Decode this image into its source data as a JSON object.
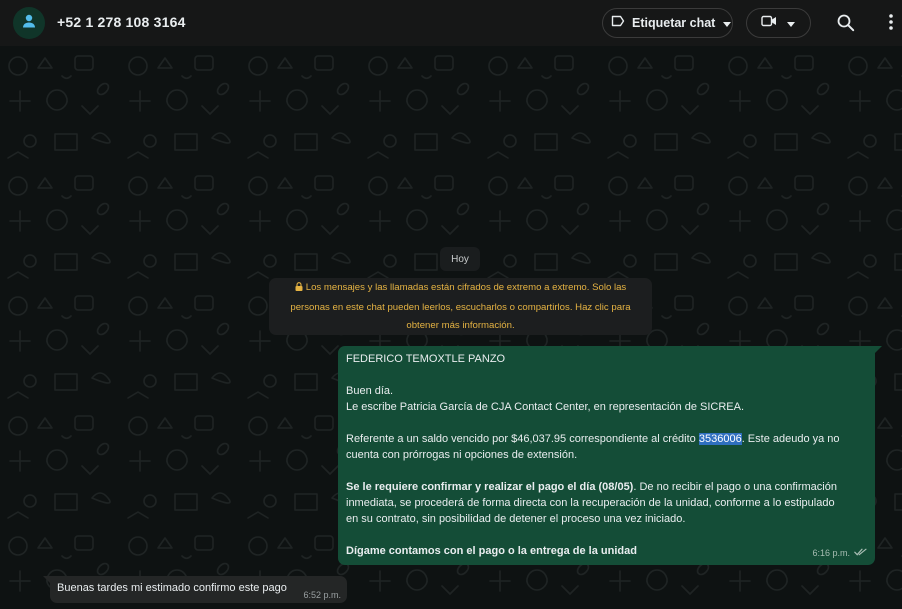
{
  "header": {
    "contact": "+52 1 278 108 3164",
    "label_button": "Etiquetar chat",
    "icons": [
      "person-icon",
      "label-icon",
      "chevron-down-icon",
      "video-icon",
      "search-icon",
      "kebab-menu-icon"
    ]
  },
  "chat": {
    "date_chip": "Hoy",
    "system_message": "Los mensajes y las llamadas están cifrados de extremo a extremo. Solo las personas en este chat pueden leerlos, escucharlos o compartirlos. Haz clic para obtener más información.",
    "system_lines": [
      "Los mensajes y las llamadas están cifrados de extremo a extremo. Solo las",
      "personas en este chat pueden leerlos, escucharlos o compartirlos. Haz clic para",
      "obtener más información."
    ],
    "outgoing": {
      "greeting_name": "FEDERICO TEMOXTLE PANZO",
      "line_hello": "Buen día.",
      "line_intro": "Le escribe Patricia García de CJA Contact Center, en representación de SICREA.",
      "ref_before": "Referente a un saldo vencido por $46,037.95 correspondiente al crédito ",
      "ref_credit": "3536006",
      "ref_after": ". Este adeudo ya no",
      "ref_line2": "cuenta con prórrogas ni opciones de extensión.",
      "req_bold": "Se le requiere confirmar y realizar el pago el día (08/05)",
      "req_rest": ". De no recibir el pago o una confirmación",
      "req_line2": "inmediata, se procederá de forma directa con la recuperación de la unidad, conforme a lo estipulado",
      "req_line3": "en su contrato, sin posibilidad de detener el proceso una vez iniciado.",
      "closing": "Dígame contamos con el pago o la entrega de la unidad",
      "time": "6:16 p.m.",
      "status": "read"
    },
    "incoming": {
      "text": "Buenas tardes mi estimado confirmo este pago",
      "time": "6:52 p.m."
    }
  },
  "colors": {
    "header_bg": "#161717",
    "chat_bg": "#0e1212",
    "outgoing_bubble": "#144d37",
    "incoming_bubble": "#242626",
    "system_text": "#e5b343",
    "selection": "#2f6fbf"
  }
}
